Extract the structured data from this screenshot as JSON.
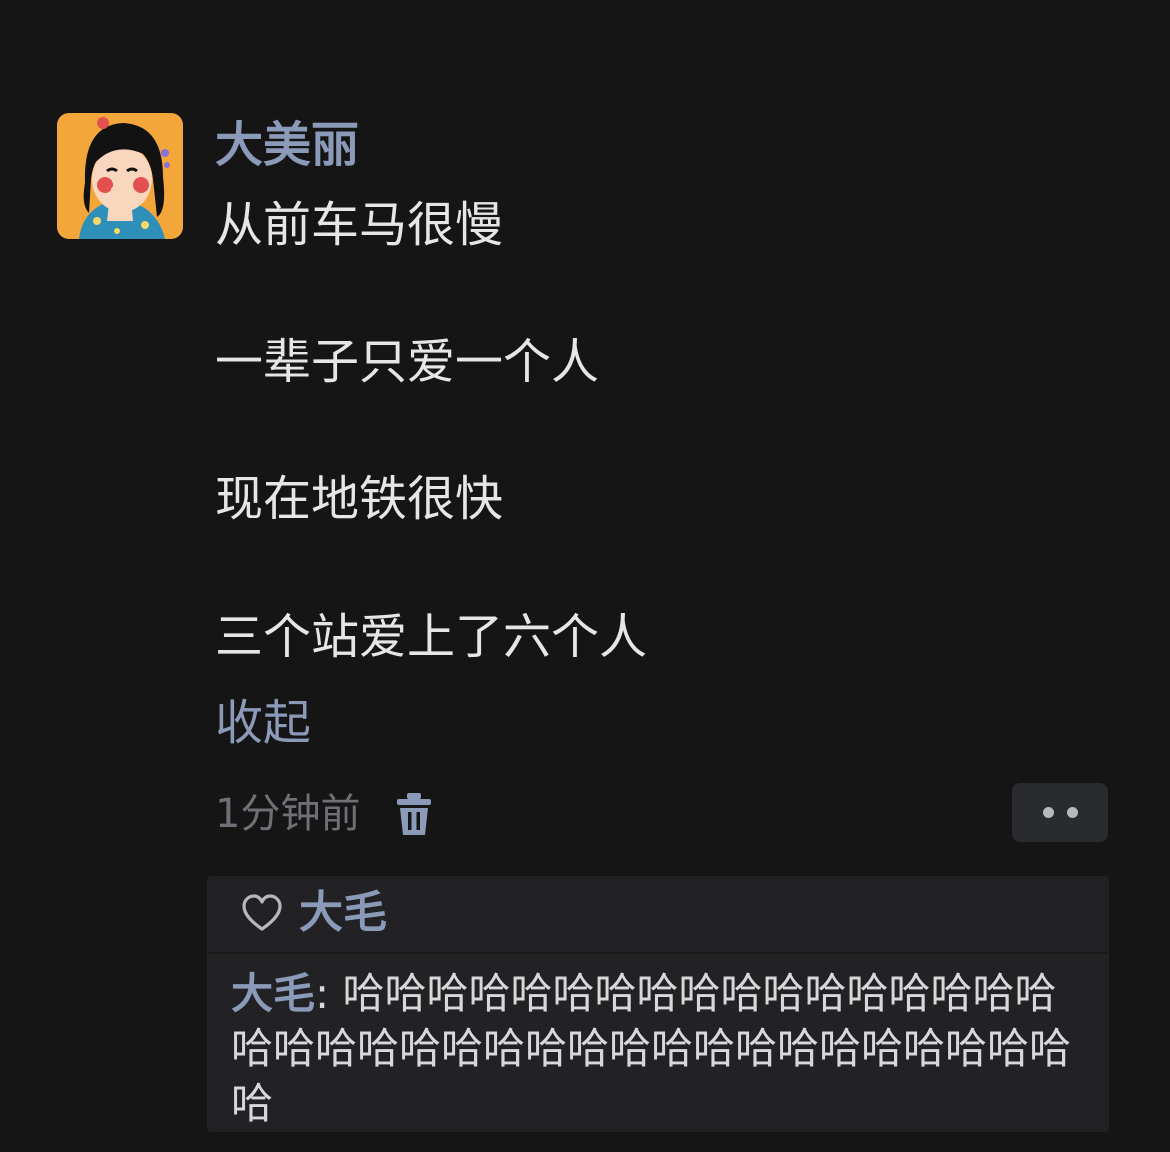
{
  "post": {
    "author": "大美丽",
    "lines": [
      "从前车马很慢",
      "一辈子只爱一个人",
      "现在地铁很快",
      "三个站爱上了六个人"
    ],
    "collapse_label": "收起",
    "timestamp": "1分钟前",
    "delete_icon": "trash-icon",
    "more_icon": "more-dots-icon"
  },
  "feedback": {
    "like_icon": "heart-outline-icon",
    "likes": "大毛",
    "comment": {
      "author": "大毛",
      "separator": ": ",
      "text": "哈哈哈哈哈哈哈哈哈哈哈哈哈哈哈哈哈哈哈哈哈哈哈哈哈哈哈哈哈哈哈哈哈哈哈哈哈哈"
    }
  },
  "colors": {
    "background": "#151516",
    "name_accent": "#8b9ab8",
    "body_text": "#e6e6e8",
    "meta_text": "#6f7075",
    "panel": "#222224"
  }
}
